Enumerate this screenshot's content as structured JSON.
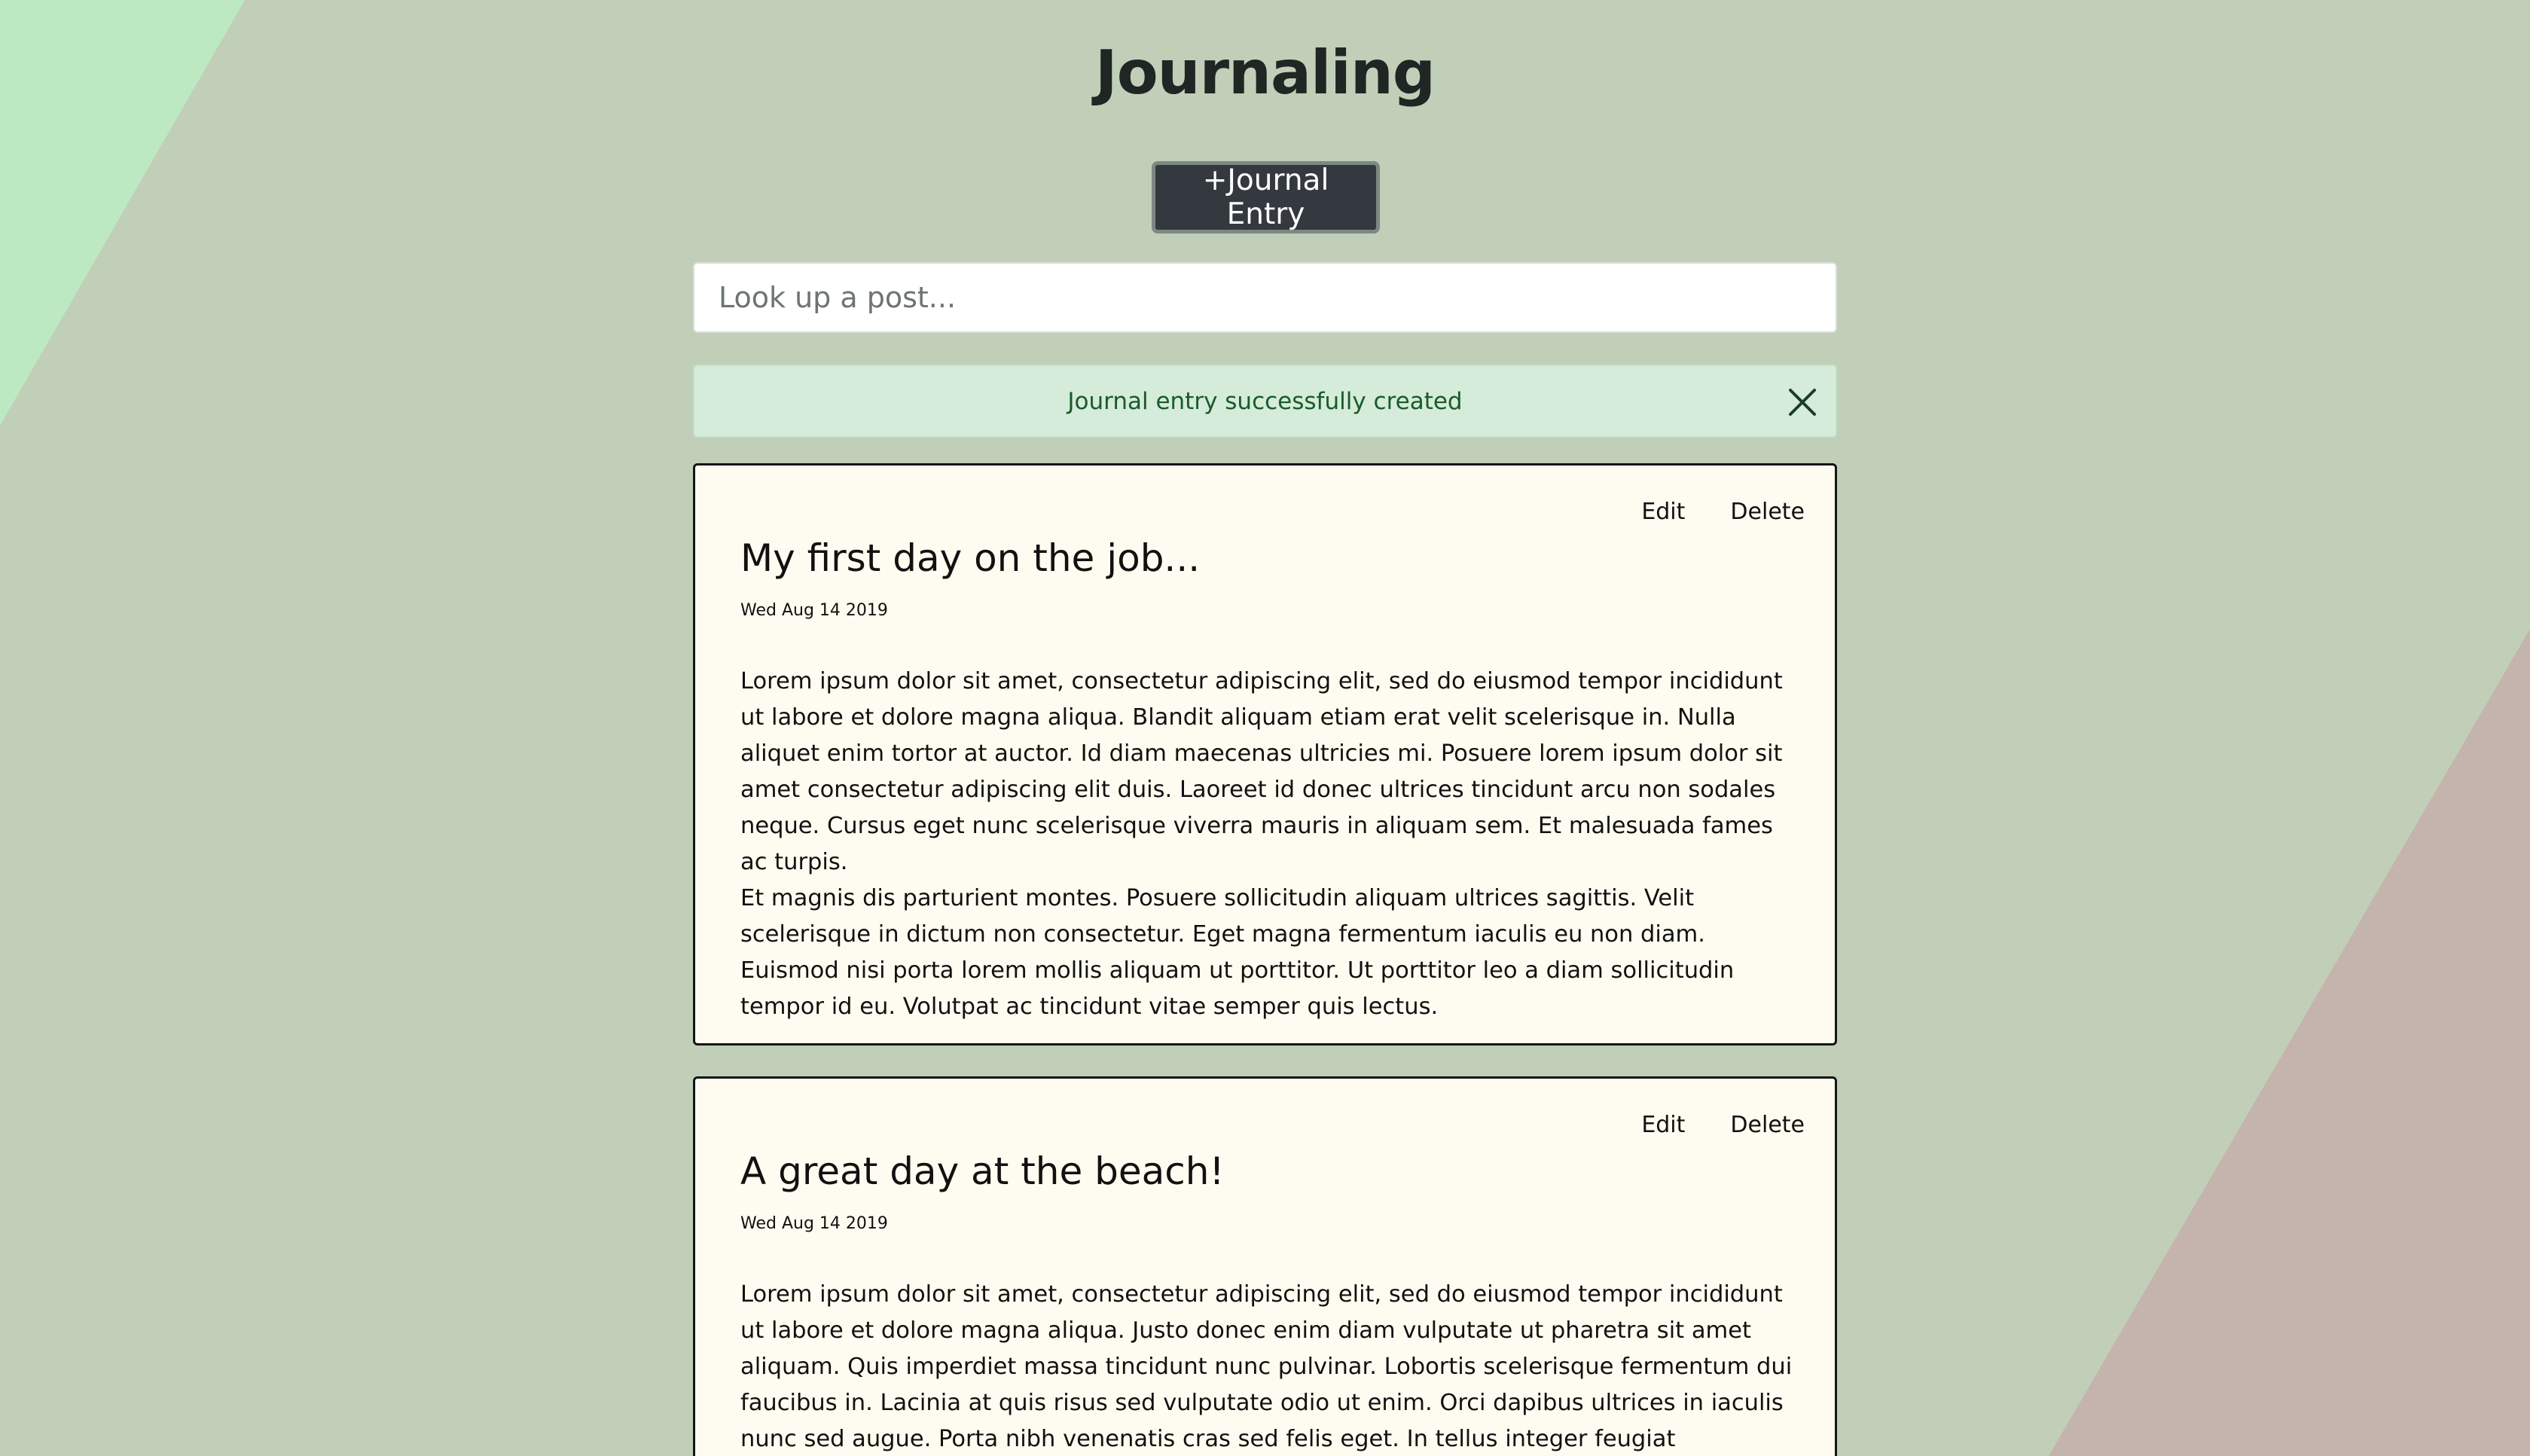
{
  "header": {
    "title": "Journaling",
    "new_entry_label": "+Journal Entry"
  },
  "search": {
    "placeholder": "Look up a post..."
  },
  "alert": {
    "message": "Journal entry successfully created"
  },
  "entries": [
    {
      "title": "My first day on the job...",
      "date": "Wed Aug 14 2019",
      "edit_label": "Edit",
      "delete_label": "Delete",
      "paragraphs": [
        "Lorem ipsum dolor sit amet, consectetur adipiscing elit, sed do eiusmod tempor incididunt ut labore et dolore magna aliqua. Blandit aliquam etiam erat velit scelerisque in. Nulla aliquet enim tortor at auctor. Id diam maecenas ultricies mi. Posuere lorem ipsum dolor sit amet consectetur adipiscing elit duis. Laoreet id donec ultrices tincidunt arcu non sodales neque. Cursus eget nunc scelerisque viverra mauris in aliquam sem. Et malesuada fames ac turpis.",
        "Et magnis dis parturient montes. Posuere sollicitudin aliquam ultrices sagittis. Velit scelerisque in dictum non consectetur. Eget magna fermentum iaculis eu non diam. Euismod nisi porta lorem mollis aliquam ut porttitor. Ut porttitor leo a diam sollicitudin tempor id eu. Volutpat ac tincidunt vitae semper quis lectus."
      ]
    },
    {
      "title": "A great day at the beach!",
      "date": "Wed Aug 14 2019",
      "edit_label": "Edit",
      "delete_label": "Delete",
      "paragraphs": [
        "Lorem ipsum dolor sit amet, consectetur adipiscing elit, sed do eiusmod tempor incididunt ut labore et dolore magna aliqua. Justo donec enim diam vulputate ut pharetra sit amet aliquam. Quis imperdiet massa tincidunt nunc pulvinar. Lobortis scelerisque fermentum dui faucibus in. Lacinia at quis risus sed vulputate odio ut enim. Orci dapibus ultrices in iaculis nunc sed augue. Porta nibh venenatis cras sed felis eget. In tellus integer feugiat scelerisque varius. Sed arcu non odio euismod lacinia. Vitae congue mauris rhoncus"
      ]
    }
  ],
  "colors": {
    "background": "#c2cfb8",
    "accent_green": "#bce9c2",
    "accent_pink": "#c4b4ad",
    "button": "#33393e",
    "card": "#fefcf0",
    "alert_bg": "#d4ecd9",
    "alert_text": "#1a5a2b"
  }
}
